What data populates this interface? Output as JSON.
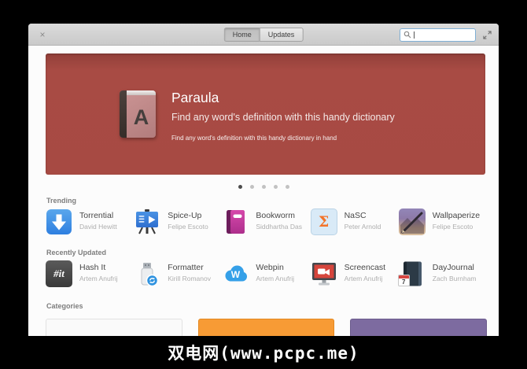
{
  "header": {
    "close": "×",
    "tabs": [
      {
        "label": "Home",
        "active": true
      },
      {
        "label": "Updates",
        "active": false
      }
    ],
    "search": {
      "value": "",
      "placeholder": ""
    }
  },
  "banner": {
    "icon_letter": "A",
    "title": "Paraula",
    "tagline": "Find any word's definition with this handy dictionary",
    "summary": "Find any word's definition with this handy dictionary in hand",
    "bg_color": "#a74a43"
  },
  "carousel": {
    "dot_count": 5,
    "active_index": 0
  },
  "trending": {
    "title": "Trending",
    "apps": [
      {
        "name": "Torrential",
        "developer": "David Hewitt",
        "icon": "down-arrow-icon"
      },
      {
        "name": "Spice-Up",
        "developer": "Felipe Escoto",
        "icon": "presentation-icon"
      },
      {
        "name": "Bookworm",
        "developer": "Siddhartha Das",
        "icon": "book-icon"
      },
      {
        "name": "NaSC",
        "developer": "Peter Arnold",
        "icon": "sigma-icon",
        "glyph": "Σ"
      },
      {
        "name": "Wallpaperize",
        "developer": "Felipe Escoto",
        "icon": "wallpaper-pen-icon"
      }
    ]
  },
  "recent": {
    "title": "Recently Updated",
    "apps": [
      {
        "name": "Hash It",
        "developer": "Artem Anufrij",
        "icon": "hash-icon",
        "glyph": "#it"
      },
      {
        "name": "Formatter",
        "developer": "Kirill Romanov",
        "icon": "usb-drive-icon"
      },
      {
        "name": "Webpin",
        "developer": "Artem Anufrij",
        "icon": "cloud-icon",
        "glyph": "W"
      },
      {
        "name": "Screencast",
        "developer": "Artem Anufrij",
        "icon": "screen-record-icon"
      },
      {
        "name": "DayJournal",
        "developer": "Zach Burnham",
        "icon": "journal-calendar-icon",
        "glyph": "7"
      }
    ]
  },
  "categories": {
    "title": "Categories",
    "cards": [
      {
        "color": "#fafafa"
      },
      {
        "color": "#f79b35"
      },
      {
        "color": "#7d6ba0"
      }
    ]
  },
  "watermark": {
    "text": "双电网(www.pcpc.me)"
  }
}
